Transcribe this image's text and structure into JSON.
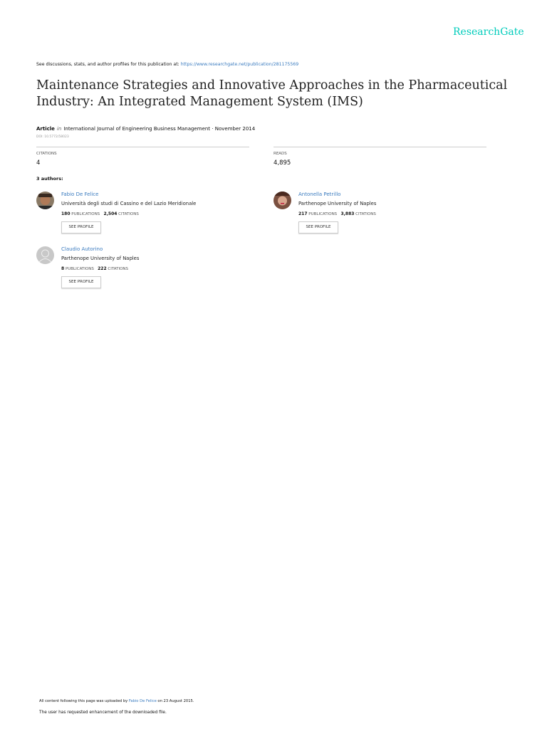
{
  "brand": "ResearchGate",
  "header": {
    "prefix": "See discussions, stats, and author profiles for this publication at: ",
    "url": "https://www.researchgate.net/publication/281175569"
  },
  "title": "Maintenance Strategies and Innovative Approaches in the Pharmaceutical Industry: An Integrated Management System (IMS)",
  "meta": {
    "type": "Article",
    "in": "in",
    "journal": "International Journal of Engineering Business Management · November 2014",
    "doi": "DOI: 10.5772/58023"
  },
  "stats": {
    "citations_label": "CITATIONS",
    "citations": "4",
    "reads_label": "READS",
    "reads": "4,895"
  },
  "authors_heading": "3 authors:",
  "authors": [
    {
      "name": "Fabio De Felice",
      "institution": "Università degli studi di Cassino e del Lazio Meridionale",
      "publications": "180",
      "citations": "2,504",
      "pub_label": "PUBLICATIONS",
      "cit_label": "CITATIONS",
      "button": "SEE PROFILE"
    },
    {
      "name": "Antonella Petrillo",
      "institution": "Parthenope University of Naples",
      "publications": "217",
      "citations": "3,883",
      "pub_label": "PUBLICATIONS",
      "cit_label": "CITATIONS",
      "button": "SEE PROFILE"
    },
    {
      "name": "Claudio Autorino",
      "institution": "Parthenope University of Naples",
      "publications": "8",
      "citations": "222",
      "pub_label": "PUBLICATIONS",
      "cit_label": "CITATIONS",
      "button": "SEE PROFILE"
    }
  ],
  "footer": {
    "upload_prefix": "All content following this page was uploaded by ",
    "uploader": "Fabio De Felice",
    "upload_suffix": " on 23 August 2015.",
    "note": "The user has requested enhancement of the downloaded file."
  }
}
